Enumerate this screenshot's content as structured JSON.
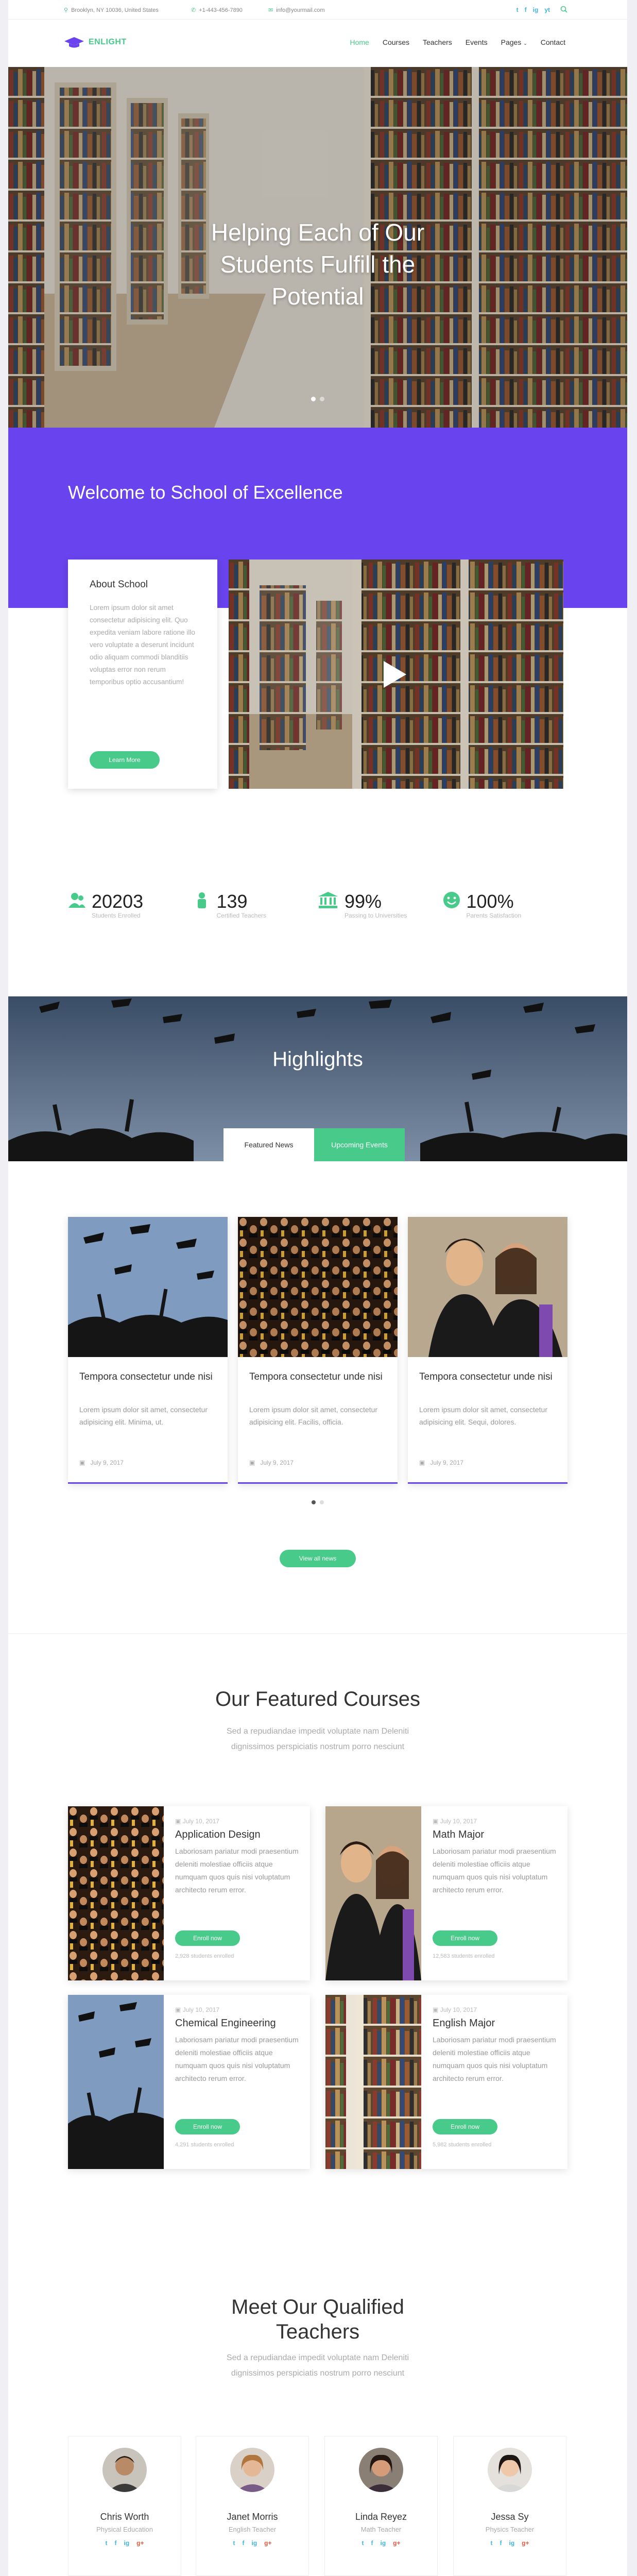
{
  "topbar": {
    "address": "Brooklyn, NY 10036, United States",
    "phone": "+1-443-456-7890",
    "email": "info@yourmail.com",
    "social": [
      "t",
      "f",
      "ig",
      "yt"
    ]
  },
  "brand": {
    "name": "ENLIGHT"
  },
  "nav": {
    "items": [
      {
        "label": "Home",
        "active": true
      },
      {
        "label": "Courses"
      },
      {
        "label": "Teachers"
      },
      {
        "label": "Events"
      },
      {
        "label": "Pages"
      },
      {
        "label": "Contact"
      }
    ]
  },
  "hero": {
    "title_line1": "Helping Each of Our",
    "title_line2": "Students Fulfill the",
    "title_line3": "Potential"
  },
  "welcome": {
    "title": "Welcome to School of Excellence"
  },
  "about": {
    "title": "About School",
    "body": "Lorem ipsum dolor sit amet consectetur adipisicing elit. Quo expedita veniam labore ratione illo vero voluptate a deserunt incidunt odio aliquam commodi blanditiis voluptas error non rerum temporibus optio accusantium!",
    "button": "Learn More"
  },
  "stats": [
    {
      "value": "20203",
      "label": "Students Enrolled"
    },
    {
      "value": "139",
      "label": "Certified Teachers"
    },
    {
      "value": "99%",
      "label": "Passing to Universities"
    },
    {
      "value": "100%",
      "label": "Parents Satisfaction"
    }
  ],
  "highlights": {
    "title": "Highlights",
    "tabs": [
      "Featured News",
      "Upcoming Events"
    ]
  },
  "news": [
    {
      "title": "Tempora consectetur unde nisi",
      "text": "Lorem ipsum dolor sit amet, consectetur adipisicing elit. Minima, ut.",
      "date": "July 9, 2017"
    },
    {
      "title": "Tempora consectetur unde nisi",
      "text": "Lorem ipsum dolor sit amet, consectetur adipisicing elit. Facilis, officia.",
      "date": "July 9, 2017"
    },
    {
      "title": "Tempora consectetur unde nisi",
      "text": "Lorem ipsum dolor sit amet, consectetur adipisicing elit. Sequi, dolores.",
      "date": "July 9, 2017"
    }
  ],
  "view_all": "View all news",
  "courses_section": {
    "title": "Our Featured Courses",
    "sub_line1": "Sed a repudiandae impedit voluptate nam Deleniti",
    "sub_line2": "dignissimos perspiciatis nostrum porro nesciunt"
  },
  "courses": [
    {
      "date": "July 10, 2017",
      "title": "Application Design",
      "text": "Laboriosam pariatur modi praesentium deleniti molestiae officiis atque numquam quos quis nisi voluptatum architecto rerum error.",
      "button": "Enroll now",
      "students": "2,928 students enrolled"
    },
    {
      "date": "July 10, 2017",
      "title": "Math Major",
      "text": "Laboriosam pariatur modi praesentium deleniti molestiae officiis atque numquam quos quis nisi voluptatum architecto rerum error.",
      "button": "Enroll now",
      "students": "12,583 students enrolled"
    },
    {
      "date": "July 10, 2017",
      "title": "Chemical Engineering",
      "text": "Laboriosam pariatur modi praesentium deleniti molestiae officiis atque numquam quos quis nisi voluptatum architecto rerum error.",
      "button": "Enroll now",
      "students": "4,291 students enrolled"
    },
    {
      "date": "July 10, 2017",
      "title": "English Major",
      "text": "Laboriosam pariatur modi praesentium deleniti molestiae officiis atque numquam quos quis nisi voluptatum architecto rerum error.",
      "button": "Enroll now",
      "students": "5,982 students enrolled"
    }
  ],
  "teachers_section": {
    "title_line1": "Meet Our Qualified",
    "title_line2": "Teachers",
    "sub_line1": "Sed a repudiandae impedit voluptate nam Deleniti",
    "sub_line2": "dignissimos perspiciatis nostrum porro nesciunt"
  },
  "teachers": [
    {
      "name": "Chris Worth",
      "role": "Physical Education"
    },
    {
      "name": "Janet Morris",
      "role": "English Teacher"
    },
    {
      "name": "Linda Reyez",
      "role": "Math Teacher"
    },
    {
      "name": "Jessa Sy",
      "role": "Physics Teacher"
    }
  ],
  "teacher_social": [
    "t",
    "f",
    "ig",
    "g+"
  ],
  "colors": {
    "accent_green": "#48cb8a",
    "accent_purple": "#6944ee",
    "social_blue": "#40b3e0"
  },
  "icons": [
    "location-icon",
    "phone-icon",
    "email-icon",
    "twitter-icon",
    "facebook-icon",
    "instagram-icon",
    "youtube-icon",
    "search-icon",
    "graduation-cap-icon",
    "play-icon",
    "calendar-icon",
    "users-icon",
    "teacher-icon",
    "university-icon",
    "smile-icon"
  ]
}
